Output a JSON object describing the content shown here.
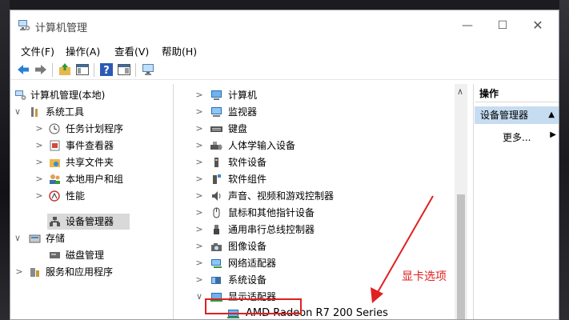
{
  "window": {
    "title": "计算机管理"
  },
  "menu": [
    {
      "label": "文件(F)"
    },
    {
      "label": "操作(A)"
    },
    {
      "label": "查看(V)"
    },
    {
      "label": "帮助(H)"
    }
  ],
  "toolbar": {
    "icons": [
      "back-arrow-icon",
      "forward-arrow-icon",
      "up-folder-icon",
      "show-hide-tree-icon",
      "help-icon",
      "properties-icon",
      "monitor-icon"
    ]
  },
  "tree": {
    "root": "计算机管理(本地)",
    "items": [
      {
        "label": "系统工具"
      },
      {
        "label": "任务计划程序"
      },
      {
        "label": "事件查看器"
      },
      {
        "label": "共享文件夹"
      },
      {
        "label": "本地用户和组"
      },
      {
        "label": "性能"
      },
      {
        "label": "设备管理器"
      },
      {
        "label": "存储"
      },
      {
        "label": "磁盘管理"
      },
      {
        "label": "服务和应用程序"
      }
    ]
  },
  "devices": [
    {
      "label": "计算机"
    },
    {
      "label": "监视器"
    },
    {
      "label": "键盘"
    },
    {
      "label": "人体学输入设备"
    },
    {
      "label": "软件设备"
    },
    {
      "label": "软件组件"
    },
    {
      "label": "声音、视频和游戏控制器"
    },
    {
      "label": "鼠标和其他指针设备"
    },
    {
      "label": "通用串行总线控制器"
    },
    {
      "label": "图像设备"
    },
    {
      "label": "网络适配器"
    },
    {
      "label": "系统设备"
    },
    {
      "label": "显示适配器"
    },
    {
      "label": "AMD Radeon R7 200 Series"
    }
  ],
  "actions": {
    "header": "操作",
    "group": "设备管理器",
    "more": "更多..."
  },
  "annotation": {
    "text": "显卡选项",
    "color": "#e02020"
  }
}
